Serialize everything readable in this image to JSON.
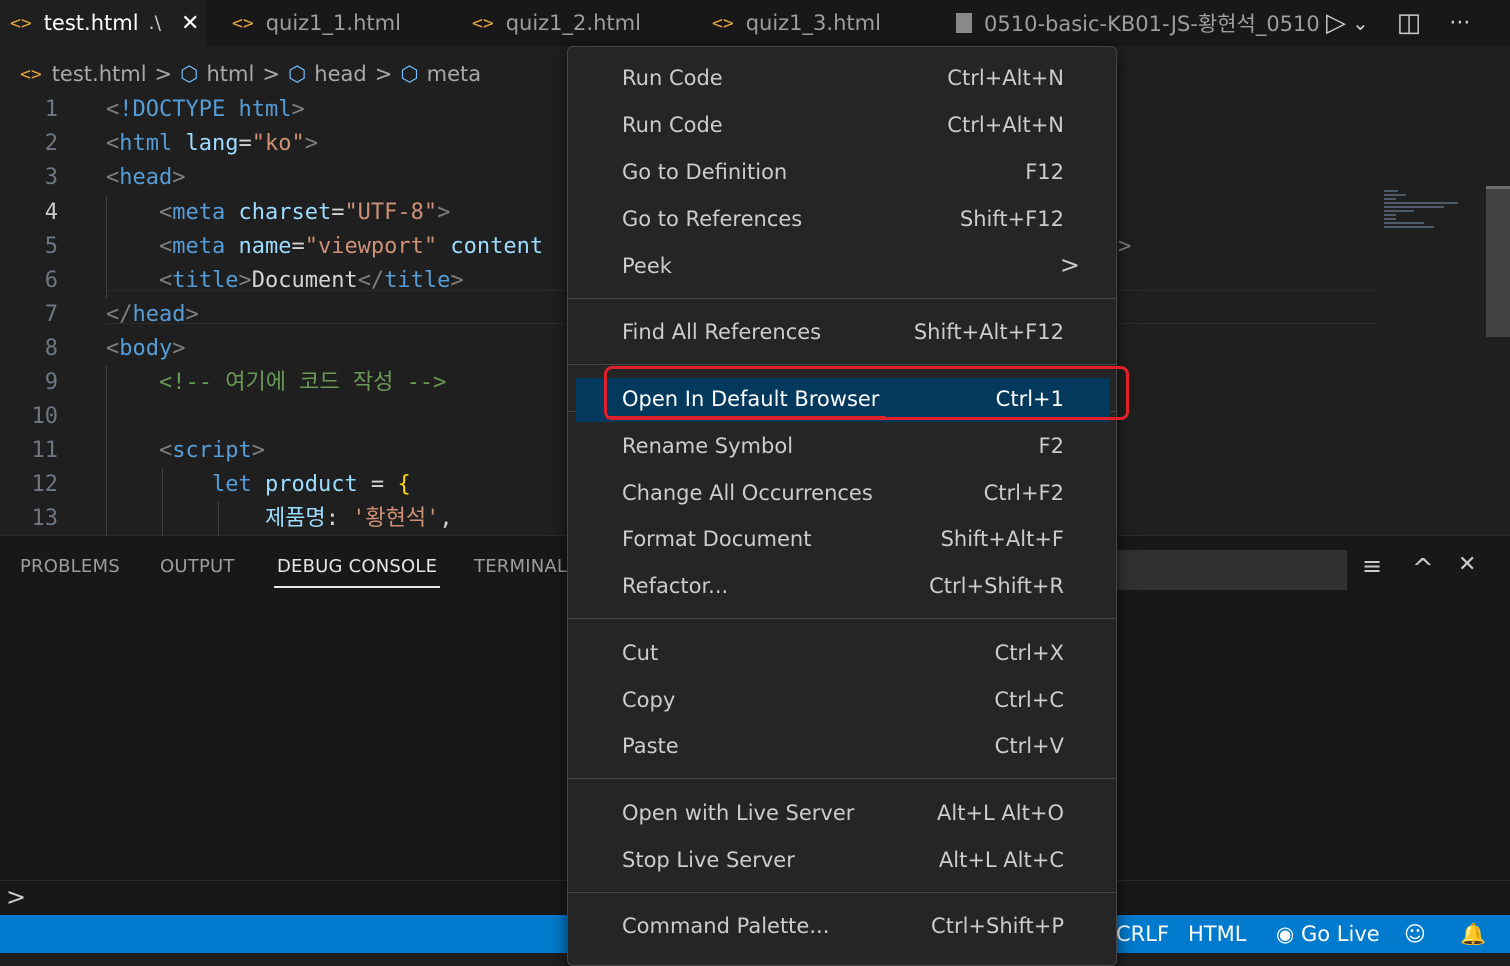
{
  "tabs": [
    {
      "label": "test.html",
      "suffix": ".\\",
      "icon": "html-icon",
      "active": true,
      "close": "✕"
    },
    {
      "label": "quiz1_1.html",
      "icon": "html-icon"
    },
    {
      "label": "quiz1_2.html",
      "icon": "html-icon"
    },
    {
      "label": "quiz1_3.html",
      "icon": "html-icon"
    },
    {
      "label": "0510-basic-KB01-JS-황현석_0510",
      "icon": "file-icon"
    }
  ],
  "tab_actions": {
    "run": "▷",
    "run_dropdown": "⌄",
    "split": "◫",
    "more": "···"
  },
  "breadcrumb": {
    "file": "test.html",
    "items": [
      "html",
      "head",
      "meta"
    ],
    "sep": ">"
  },
  "editor": {
    "line_numbers": [
      "1",
      "2",
      "3",
      "4",
      "5",
      "6",
      "7",
      "8",
      "9",
      "10",
      "11",
      "12",
      "13"
    ],
    "current_line": 4,
    "lines": [
      [
        [
          "br",
          "<"
        ],
        [
          "tag",
          "!DOCTYPE"
        ],
        [
          "txt",
          " "
        ],
        [
          "tag",
          "html"
        ],
        [
          "br",
          ">"
        ]
      ],
      [
        [
          "br",
          "<"
        ],
        [
          "tag",
          "html"
        ],
        [
          "txt",
          " "
        ],
        [
          "attr",
          "lang"
        ],
        [
          "txt",
          "="
        ],
        [
          "str",
          "\"ko\""
        ],
        [
          "br",
          ">"
        ]
      ],
      [
        [
          "br",
          "<"
        ],
        [
          "tag",
          "head"
        ],
        [
          "br",
          ">"
        ]
      ],
      [
        [
          "txt",
          "    "
        ],
        [
          "br",
          "<"
        ],
        [
          "tag",
          "meta"
        ],
        [
          "txt",
          " "
        ],
        [
          "attr",
          "charset"
        ],
        [
          "txt",
          "="
        ],
        [
          "str",
          "\"UTF-8\""
        ],
        [
          "br",
          ">"
        ]
      ],
      [
        [
          "txt",
          "    "
        ],
        [
          "br",
          "<"
        ],
        [
          "tag",
          "meta"
        ],
        [
          "txt",
          " "
        ],
        [
          "attr",
          "name"
        ],
        [
          "txt",
          "="
        ],
        [
          "str",
          "\"viewport\""
        ],
        [
          "txt",
          " "
        ],
        [
          "attr",
          "content"
        ]
      ],
      [
        [
          "txt",
          "    "
        ],
        [
          "br",
          "<"
        ],
        [
          "tag",
          "title"
        ],
        [
          "br",
          ">"
        ],
        [
          "txt",
          "Document"
        ],
        [
          "br",
          "</"
        ],
        [
          "tag",
          "title"
        ],
        [
          "br",
          ">"
        ]
      ],
      [
        [
          "br",
          "</"
        ],
        [
          "tag",
          "head"
        ],
        [
          "br",
          ">"
        ]
      ],
      [
        [
          "br",
          "<"
        ],
        [
          "tag",
          "body"
        ],
        [
          "br",
          ">"
        ]
      ],
      [
        [
          "txt",
          "    "
        ],
        [
          "cmt",
          "<!-- 여기에 코드 작성 -->"
        ]
      ],
      [
        [
          "txt",
          ""
        ]
      ],
      [
        [
          "txt",
          "    "
        ],
        [
          "br",
          "<"
        ],
        [
          "tag",
          "script"
        ],
        [
          "br",
          ">"
        ]
      ],
      [
        [
          "txt",
          "        "
        ],
        [
          "kw",
          "let"
        ],
        [
          "txt",
          " "
        ],
        [
          "var",
          "product"
        ],
        [
          "txt",
          " = "
        ],
        [
          "brace",
          "{"
        ]
      ],
      [
        [
          "txt",
          "            "
        ],
        [
          "var",
          "제품명"
        ],
        [
          "txt",
          ": "
        ],
        [
          "str",
          "'황현석'"
        ],
        [
          "txt",
          ","
        ]
      ]
    ],
    "overflow_glyph": ">"
  },
  "panel": {
    "tabs": [
      "PROBLEMS",
      "OUTPUT",
      "DEBUG CONSOLE",
      "TERMINAL"
    ],
    "active_tab": "DEBUG CONSOLE",
    "actions": {
      "clear": "≡",
      "maximize": "^",
      "close": "✕"
    },
    "prompt": ">"
  },
  "statusbar": {
    "eol": "CRLF",
    "language": "HTML",
    "go_live": "Go Live",
    "go_live_icon": "broadcast-icon",
    "feedback_icon": "feedback-icon",
    "bell_icon": "bell-icon"
  },
  "context_menu": {
    "items": [
      {
        "label": "Run Code",
        "key": "Ctrl+Alt+N"
      },
      {
        "label": "Run Code",
        "key": "Ctrl+Alt+N"
      },
      {
        "label": "Go to Definition",
        "key": "F12"
      },
      {
        "label": "Go to References",
        "key": "Shift+F12"
      },
      {
        "label": "Peek",
        "key": "",
        "submenu": true
      },
      {
        "label": "Find All References",
        "key": "Shift+Alt+F12"
      },
      {
        "label": "Open In Default Browser",
        "key": "Ctrl+1",
        "selected": true
      },
      {
        "label": "Rename Symbol",
        "key": "F2"
      },
      {
        "label": "Change All Occurrences",
        "key": "Ctrl+F2"
      },
      {
        "label": "Format Document",
        "key": "Shift+Alt+F"
      },
      {
        "label": "Refactor...",
        "key": "Ctrl+Shift+R"
      },
      {
        "label": "Cut",
        "key": "Ctrl+X"
      },
      {
        "label": "Copy",
        "key": "Ctrl+C"
      },
      {
        "label": "Paste",
        "key": "Ctrl+V"
      },
      {
        "label": "Open with Live Server",
        "key": "Alt+L Alt+O"
      },
      {
        "label": "Stop Live Server",
        "key": "Alt+L Alt+C"
      },
      {
        "label": "Command Palette...",
        "key": "Ctrl+Shift+P"
      }
    ],
    "submenu_arrow": ">"
  },
  "colors": {
    "statusbar": "#007acc",
    "selection": "#04395e",
    "annotation": "#e0202a",
    "html_icon": "#e3a43c"
  }
}
